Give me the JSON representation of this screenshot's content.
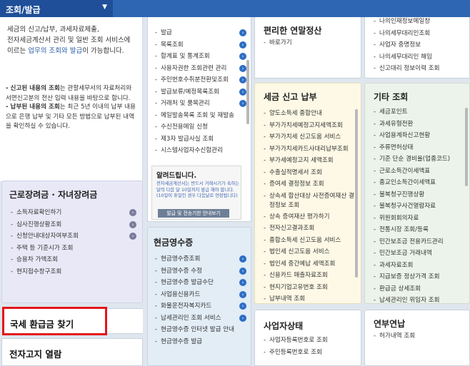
{
  "menu": {
    "tab_label": "조회/발급",
    "chevron": "▼"
  },
  "intro": {
    "line1": "세금의 신고/납부, 과세자료제출,",
    "line2": "전자세금계산서 관리 및 일반 조회 서비스에",
    "line3_pre": "이르는 ",
    "line3_hl": "업무의 조회와 발급",
    "line3_post": "이 가능합니다.",
    "b1_head": "- 신고된 내용의 조회",
    "b1_text": "는 관할세무서의 자료처리와 서면신고분의 전산 입력 내용을 바탕으로 합니다.",
    "b2_head": "- 납부된 내용의 조회",
    "b2_text": "는 최근 5년 이내의 납부 내용으로 은행 납부 및 기타 모든 방법으로 납부된 내역을 확인하실 수 있습니다."
  },
  "col1": {
    "eitc_title": "근로장려금 · 자녀장려금",
    "eitc_items": [
      "소득자료확인하기",
      "심사진행상황조회",
      "신청안내대상자여부조회",
      "주택 등 기준시가 조회",
      "승용차 가액조회",
      "현지접수창구조회"
    ],
    "refund_title": "국세 환급금 찾기",
    "ebill_title": "전자고지 열람"
  },
  "col2": {
    "top_items": [
      "발급",
      "목록조회",
      "합계표 및 통계조회",
      "사용자권한 조회관련 관리",
      "주민번호수취분전환및조회",
      "발급보류/예정목록조회",
      "거래처 및 품목관리",
      "메일발송목록 조회 및 재발송",
      "수신전용메일 신청",
      "제3자 발급사실 조회",
      "시스템사업자수신함관리"
    ],
    "notice_title": "알려드립니다.",
    "notice_text": "전자세금계산서는 반드시 거래시기가 속하는 달의 다음 달 10일까지 발급 해야 합니다. (10일이 휴일인 경우 다음날로 연장됩니다)",
    "notice_button": "발급 및 전송기한 안내보기",
    "cash_title": "현금영수증",
    "cash_items": [
      "현금영수증조회",
      "현금영수증 수정",
      "현금영수증 발급수단",
      "사업용신용카드",
      "화물운전자복지카드",
      "납세관리인 조회 서비스",
      "현금영수증 인터넷 발급 안내",
      "현금영수증 발급"
    ]
  },
  "col3": {
    "yearend_title": "편리한 연말정산",
    "yearend_items": [
      "바로가기"
    ],
    "tax_title": "세금 신고 납부",
    "tax_items": [
      "양도소득세 종합안내",
      "부가가치세예정고지세액조회",
      "부가가치세 신고도움 서비스",
      "부가가치세카드사대리납부조회",
      "부가세예정고지 세액조회",
      "수출실적명세서 조회",
      "증여세 결정정보 조회",
      "상속세 합산대상 사전증여재산 결정정보 조회",
      "상속 증여재산 평가하기",
      "전자신고결과조회",
      "종합소득세 신고도움 서비스",
      "법인세 신고도움 서비스",
      "법인세 중간예납 세액조회",
      "신용카드 매출자료조회",
      "현지기업고유번호 조회",
      "납부내역 조회"
    ],
    "biz_title": "사업자상태",
    "biz_items": [
      "사업자등록번호로 조회",
      "주민등록번호로 조회"
    ]
  },
  "col4": {
    "top_items": [
      "나의인재정보메일창",
      "나의세무대리인조회",
      "사업자 중명정보",
      "나의세무대리인 해임",
      "신고대리 정보이력 조회"
    ],
    "etc_title": "기타 조회",
    "etc_items": [
      "세금포인트",
      "과세유형전환",
      "사업용계좌신고현황",
      "주류면허상태",
      "기준 단순 경비율(업종코드)",
      "근로소득간이세액표",
      "종교인소득간이세액표",
      "불복청구진행상황",
      "불복청구사건열람자료",
      "위원회회의자료",
      "전통시장 조회/등록",
      "민간보조금 전용카드관리",
      "민간보조금 거래내역",
      "과세자료조회",
      "지급보증 정상가격 조회",
      "환급금 상세조회",
      "납세관리인 위임자 조회"
    ],
    "yr_title": "연부연납",
    "yr_items": [
      "허가내역 조회"
    ]
  }
}
